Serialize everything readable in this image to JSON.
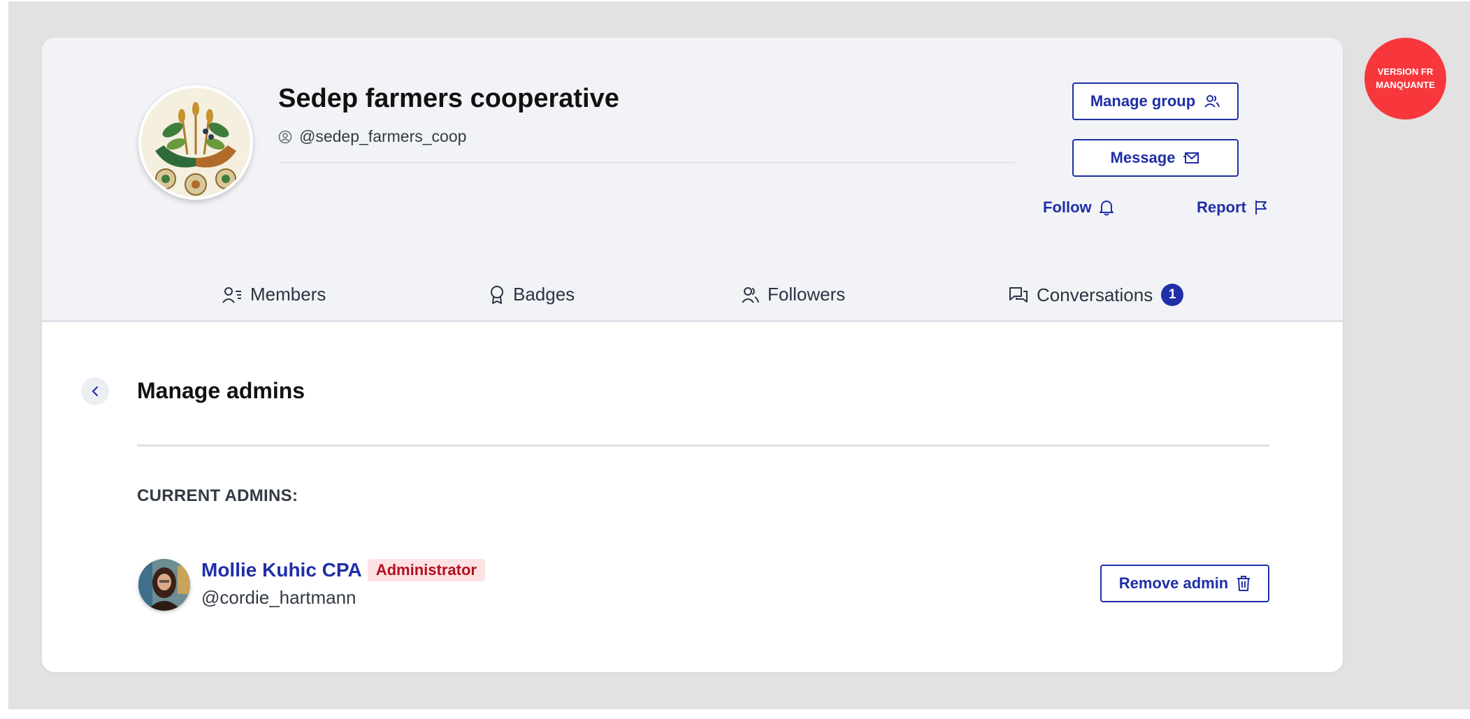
{
  "group": {
    "name": "Sedep farmers cooperative",
    "handle": "@sedep_farmers_coop"
  },
  "actions": {
    "manage_group": "Manage group",
    "message": "Message",
    "follow": "Follow",
    "report": "Report"
  },
  "tabs": [
    {
      "label": "Members",
      "icon": "members-icon"
    },
    {
      "label": "Badges",
      "icon": "badge-icon"
    },
    {
      "label": "Followers",
      "icon": "followers-icon"
    },
    {
      "label": "Conversations",
      "icon": "conversations-icon",
      "count": "1"
    }
  ],
  "manage_admins": {
    "title": "Manage admins",
    "current_label": "CURRENT ADMINS:",
    "admins": [
      {
        "name": "Mollie Kuhic CPA",
        "role": "Administrator",
        "handle": "@cordie_hartmann",
        "action": "Remove admin"
      }
    ]
  },
  "version_badge": {
    "line1": "VERSION FR",
    "line2": "MANQUANTE"
  },
  "colors": {
    "primary": "#1f2fa8",
    "badge_red": "#f7373c",
    "role_bg": "#fde2e4",
    "role_text": "#b3101e",
    "header_bg": "#f2f3f6",
    "page_bg": "#e2e2e2"
  }
}
